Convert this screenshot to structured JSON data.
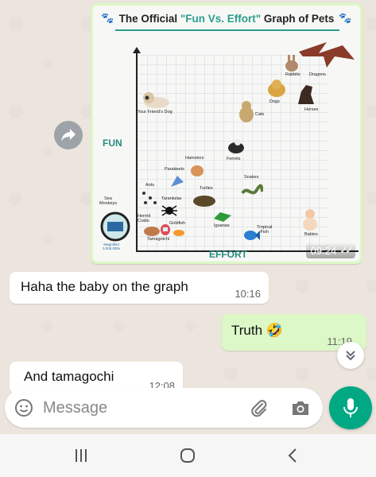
{
  "image_message": {
    "graph": {
      "title_prefix": "The Official ",
      "title_quote": "\"Fun Vs. Effort\"",
      "title_suffix": " Graph of Pets",
      "y_axis_label": "FUN",
      "x_axis_label": "EFFORT",
      "pets": [
        {
          "id": "rabbits",
          "label": "Rabbits"
        },
        {
          "id": "dragons",
          "label": "Dragons"
        },
        {
          "id": "dogs",
          "label": "Dogs"
        },
        {
          "id": "horses",
          "label": "Horses"
        },
        {
          "id": "friends-dog",
          "label": "Your Friend's Dog"
        },
        {
          "id": "cats",
          "label": "Cats"
        },
        {
          "id": "hamsters",
          "label": "Hamsters"
        },
        {
          "id": "ferrets",
          "label": "Ferrets"
        },
        {
          "id": "parakeets",
          "label": "Parakeets"
        },
        {
          "id": "snakes",
          "label": "Snakes"
        },
        {
          "id": "ants",
          "label": "Ants"
        },
        {
          "id": "turtles",
          "label": "Turtles"
        },
        {
          "id": "tarantulas",
          "label": "Tarantulas"
        },
        {
          "id": "sea-monkeys",
          "label": "Sea\nMonkeys"
        },
        {
          "id": "hermit-crabs",
          "label": "Hermit\nCrabs"
        },
        {
          "id": "goldfish",
          "label": "Goldfish"
        },
        {
          "id": "iguanas",
          "label": "Iguanas"
        },
        {
          "id": "tropical-fish",
          "label": "Tropical\nFish"
        },
        {
          "id": "babies",
          "label": "Babies"
        },
        {
          "id": "tamagotchi",
          "label": "Tamagotchi"
        },
        {
          "id": "magnified",
          "label": "Magnified\n3,000,000x"
        }
      ]
    },
    "time": "09:24"
  },
  "messages": [
    {
      "direction": "in",
      "text": "Haha the baby on the graph",
      "time": "10:16"
    },
    {
      "direction": "out",
      "text": "Truth 🤣",
      "time": "11:19"
    },
    {
      "direction": "in",
      "text": "And tamagochi",
      "time": "12:08"
    }
  ],
  "composer": {
    "placeholder": "Message"
  },
  "colors": {
    "accent": "#00a884",
    "outgoing_bubble": "#dcf8c6",
    "incoming_bubble": "#ffffff",
    "chat_bg": "#ece5dd"
  },
  "icons": [
    "forward-icon",
    "chevron-down-double-icon",
    "emoji-icon",
    "paperclip-icon",
    "camera-icon",
    "microphone-icon",
    "nav-recents-icon",
    "nav-home-icon",
    "nav-back-icon"
  ]
}
